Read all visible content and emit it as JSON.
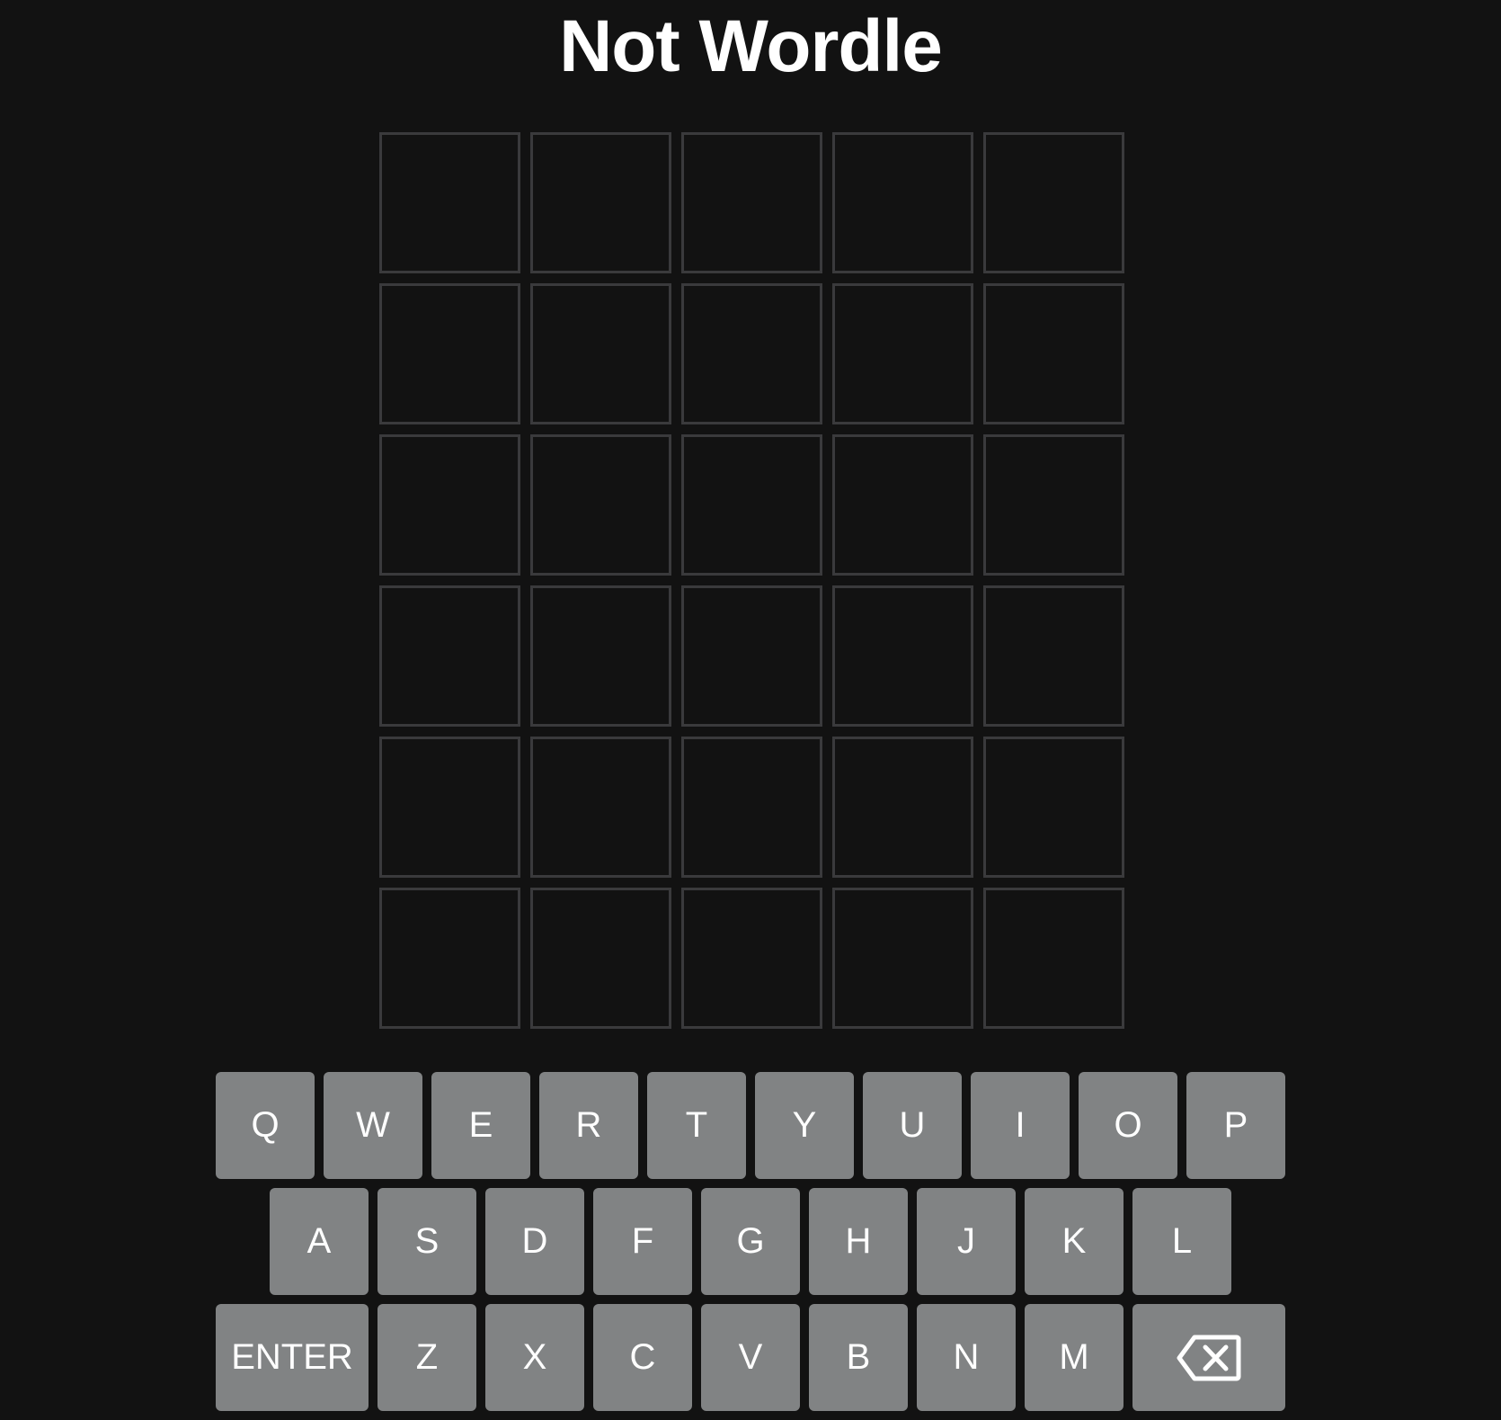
{
  "header": {
    "title": "Not Wordle"
  },
  "board": {
    "rows": [
      [
        "",
        "",
        "",
        "",
        ""
      ],
      [
        "",
        "",
        "",
        "",
        ""
      ],
      [
        "",
        "",
        "",
        "",
        ""
      ],
      [
        "",
        "",
        "",
        "",
        ""
      ],
      [
        "",
        "",
        "",
        "",
        ""
      ],
      [
        "",
        "",
        "",
        "",
        ""
      ]
    ]
  },
  "keyboard": {
    "row1": [
      "Q",
      "W",
      "E",
      "R",
      "T",
      "Y",
      "U",
      "I",
      "O",
      "P"
    ],
    "row2": [
      "A",
      "S",
      "D",
      "F",
      "G",
      "H",
      "J",
      "K",
      "L"
    ],
    "row3": [
      "Z",
      "X",
      "C",
      "V",
      "B",
      "N",
      "M"
    ],
    "enter_label": "ENTER",
    "backspace_icon": "backspace-icon"
  },
  "colors": {
    "background": "#121212",
    "tile_border": "#3a3a3c",
    "key": "#818384",
    "text": "#ffffff"
  }
}
